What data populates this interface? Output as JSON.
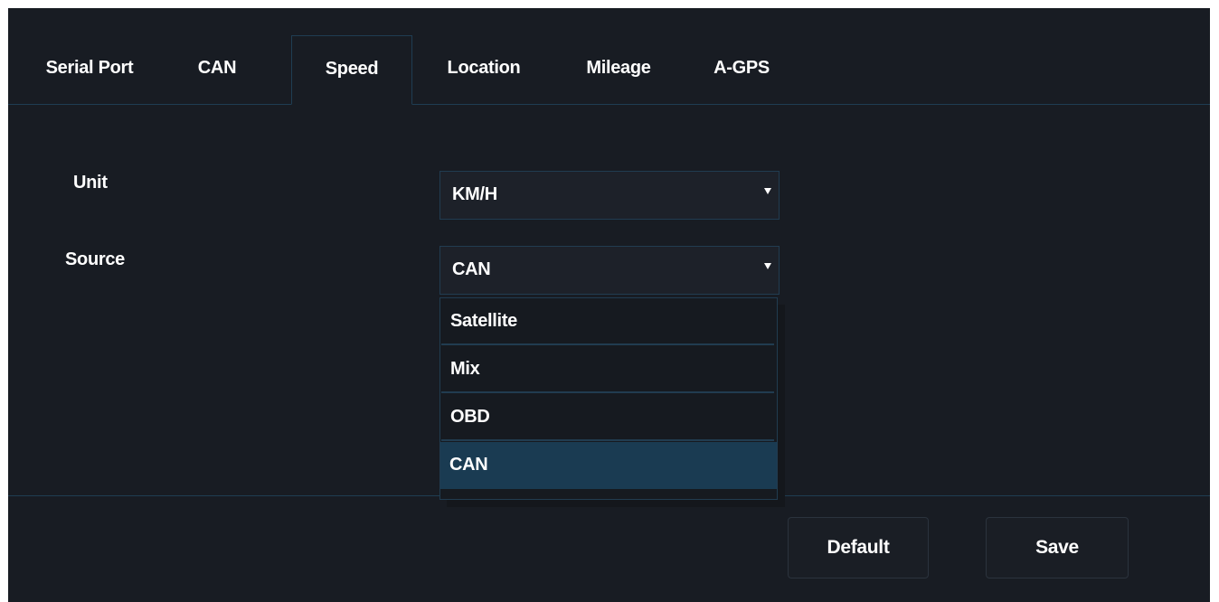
{
  "tabs": [
    {
      "label": "Serial Port",
      "active": false
    },
    {
      "label": "CAN",
      "active": false
    },
    {
      "label": "Speed",
      "active": true
    },
    {
      "label": "Location",
      "active": false
    },
    {
      "label": "Mileage",
      "active": false
    },
    {
      "label": "A-GPS",
      "active": false
    }
  ],
  "form": {
    "unit": {
      "label": "Unit",
      "value": "KM/H"
    },
    "source": {
      "label": "Source",
      "value": "CAN",
      "options": [
        "Satellite",
        "Mix",
        "OBD",
        "CAN"
      ],
      "highlighted": "CAN"
    }
  },
  "buttons": {
    "default_label": "Default",
    "save_label": "Save"
  },
  "colors": {
    "background": "#181c23",
    "border_accent": "#1f3d52",
    "selected_option": "#1a3b52",
    "text": "#ffffff"
  }
}
